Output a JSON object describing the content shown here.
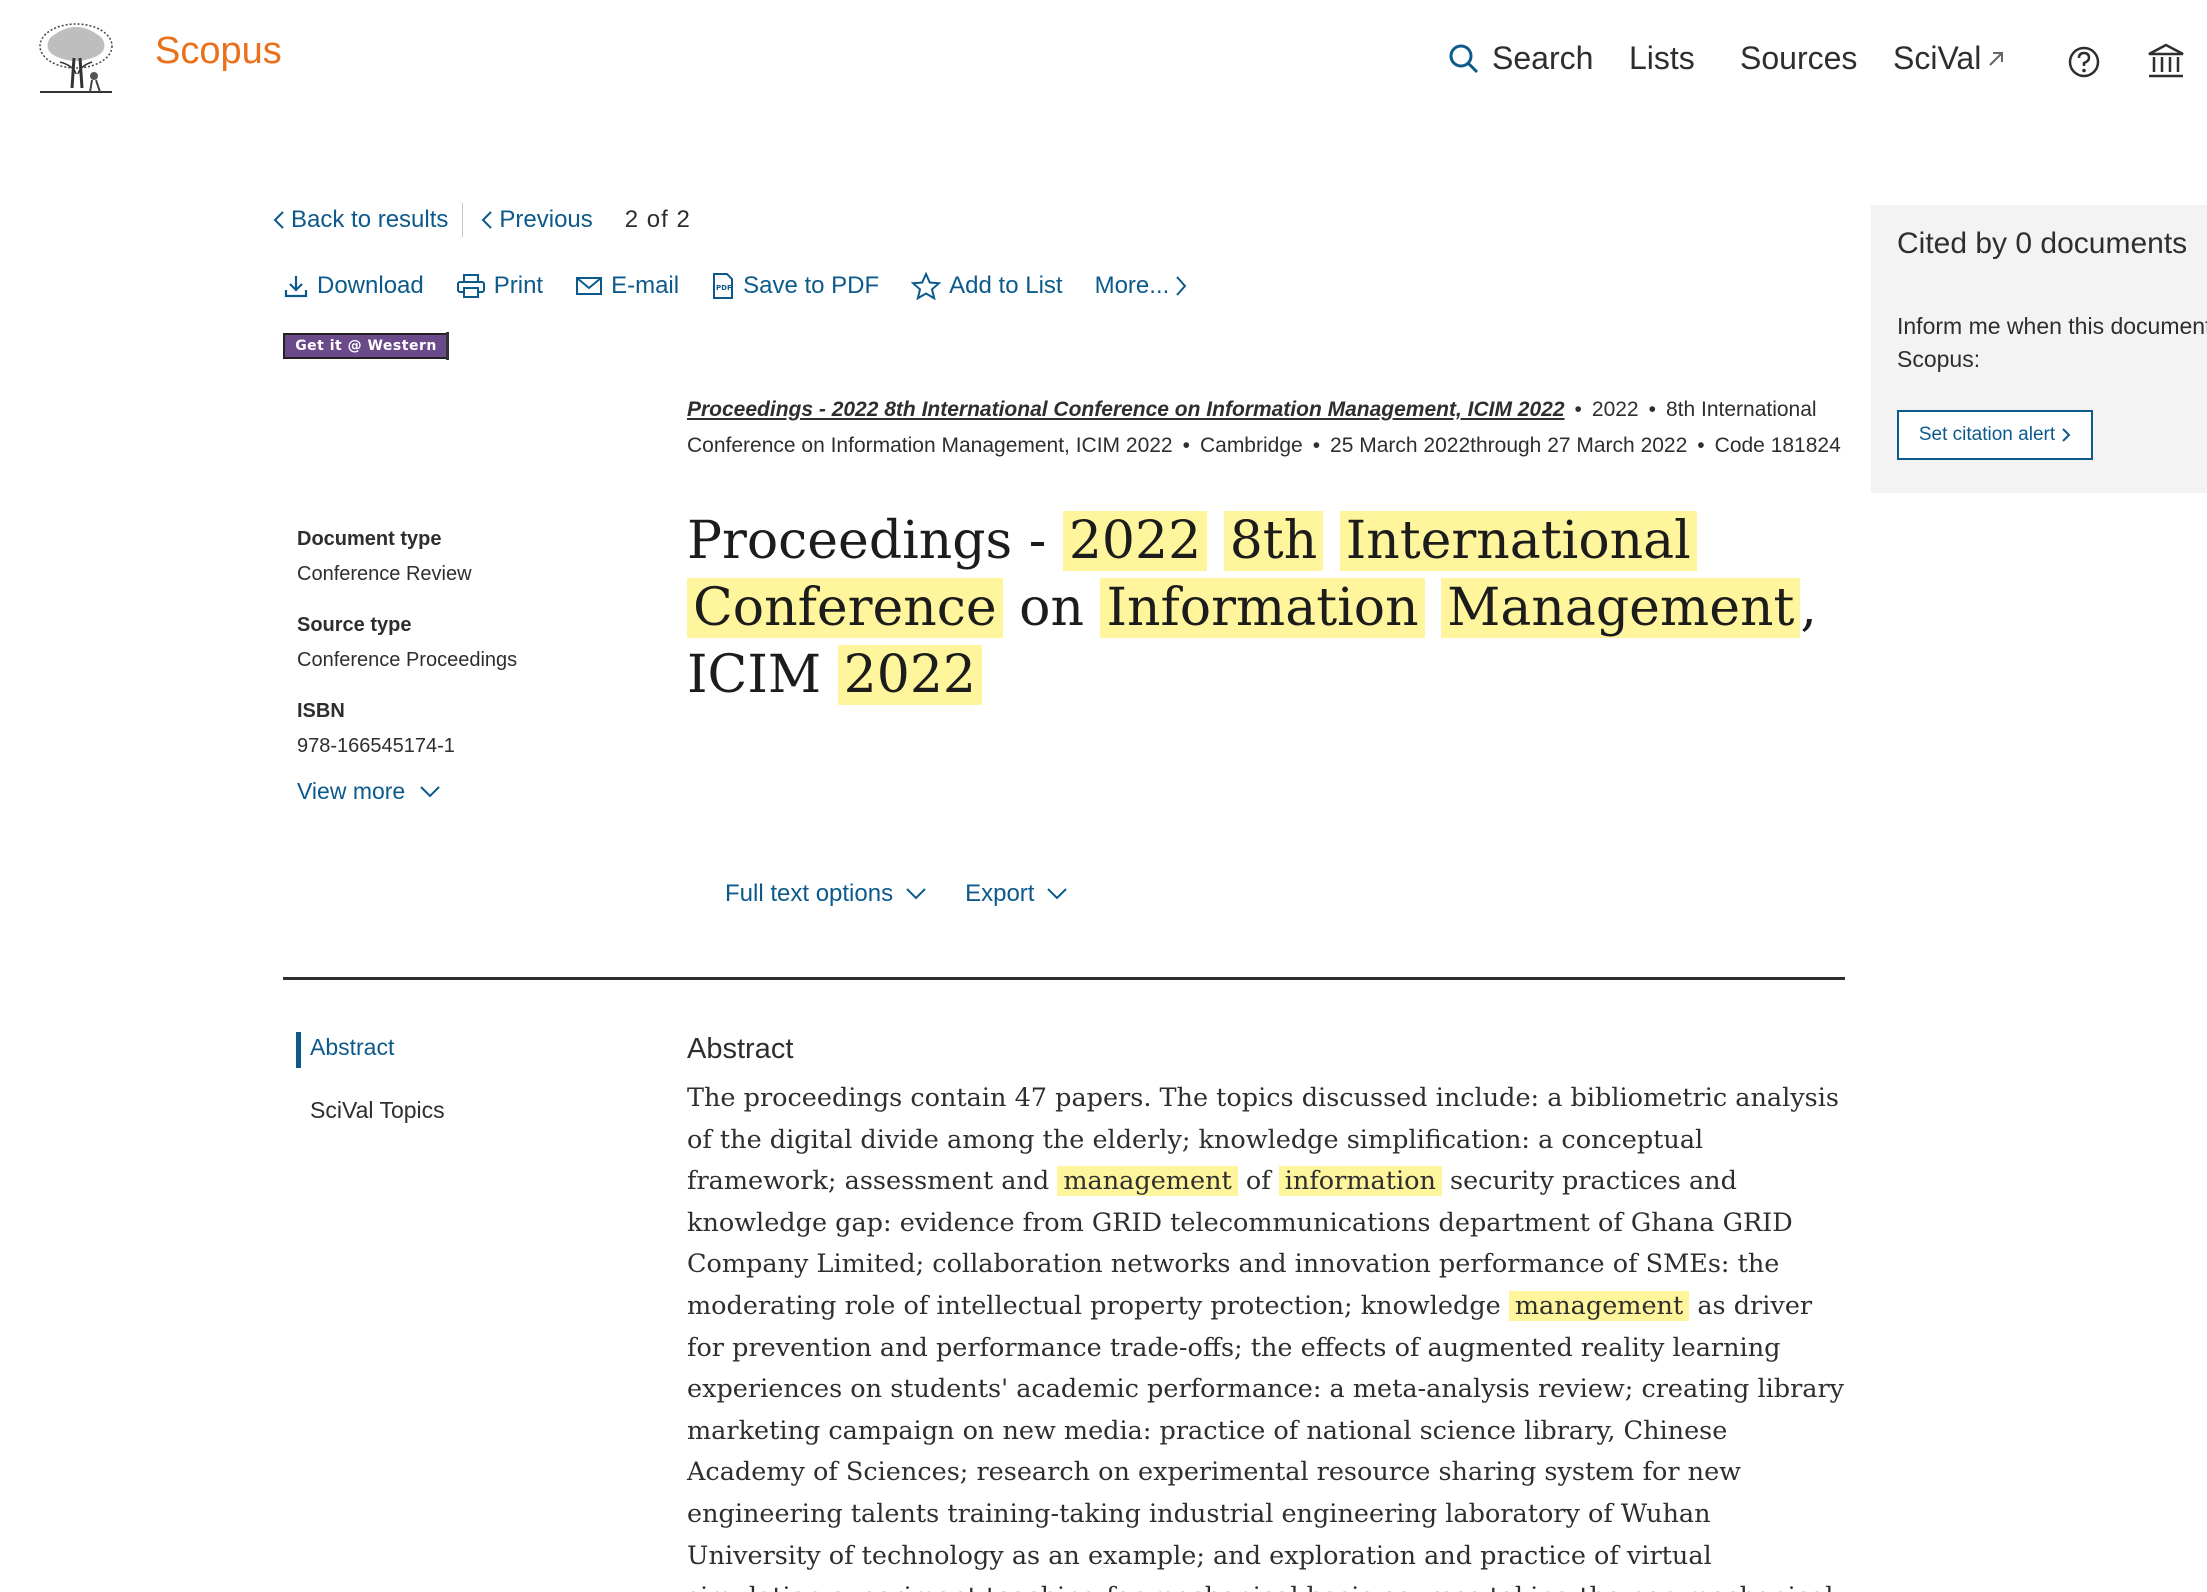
{
  "header": {
    "brand": "Scopus",
    "nav": {
      "search": "Search",
      "lists": "Lists",
      "sources": "Sources",
      "scival": "SciVal"
    },
    "accent_color": "#e9711c",
    "link_color": "#0c5a8c"
  },
  "navigation": {
    "back": "Back to results",
    "previous": "Previous",
    "page_count": "2 of 2"
  },
  "actions": {
    "download": "Download",
    "print": "Print",
    "email": "E-mail",
    "save_pdf": "Save to PDF",
    "add_list": "Add to List",
    "more": "More..."
  },
  "getit": "Get it @ Western",
  "source": {
    "title": "Proceedings - 2022 8th International Conference on Information Management, ICIM 2022",
    "year": "2022",
    "conference": "8th International Conference on Information Management, ICIM 2022",
    "location": "Cambridge",
    "dates": "25 March 2022through 27 March 2022",
    "code": "Code 181824"
  },
  "title": {
    "w1": "Proceedings -",
    "w2": "2022",
    "w3": "8th",
    "w4": "International",
    "w5": "Conference",
    "w6": "on",
    "w7": "Information",
    "w8": "Management",
    "w9": ", ICIM",
    "w10": "2022"
  },
  "meta": {
    "doc_type_label": "Document type",
    "doc_type": "Conference Review",
    "source_type_label": "Source type",
    "source_type": "Conference Proceedings",
    "isbn_label": "ISBN",
    "isbn": "978-166545174-1",
    "view_more": "View more"
  },
  "fulltext": {
    "options": "Full text options",
    "export": "Export"
  },
  "sidenav": {
    "abstract": "Abstract",
    "topics": "SciVal Topics"
  },
  "abstract": {
    "heading": "Abstract",
    "p1": "The proceedings contain 47 papers. The topics discussed include: a bibliometric analysis of the digital divide among the elderly; knowledge simplification: a conceptual framework; assessment and",
    "h1": "management",
    "p2": "of",
    "h2": "information",
    "p3": "security practices and knowledge gap: evidence from GRID telecommunications department of Ghana GRID Company Limited; collaboration networks and innovation performance of SMEs: the moderating role of intellectual property protection; knowledge",
    "h3": "management",
    "p4": "as driver for prevention and performance trade-offs; the effects of augmented reality learning experiences on students' academic performance: a meta-analysis review; creating library marketing campaign on new media: practice of national science library, Chinese Academy of Sciences; research on experimental resource sharing system for new engineering talents training-taking industrial engineering laboratory of Wuhan University of technology as an example; and exploration and practice of virtual simulation experiment teaching for mechanical basic courses taking the non-mechanical major as an example."
  },
  "cited": {
    "title": "Cited by 0 documents",
    "inform_line1": "Inform me when this document is cited in",
    "inform_line2": "Scopus:",
    "alert_button": "Set citation alert"
  }
}
